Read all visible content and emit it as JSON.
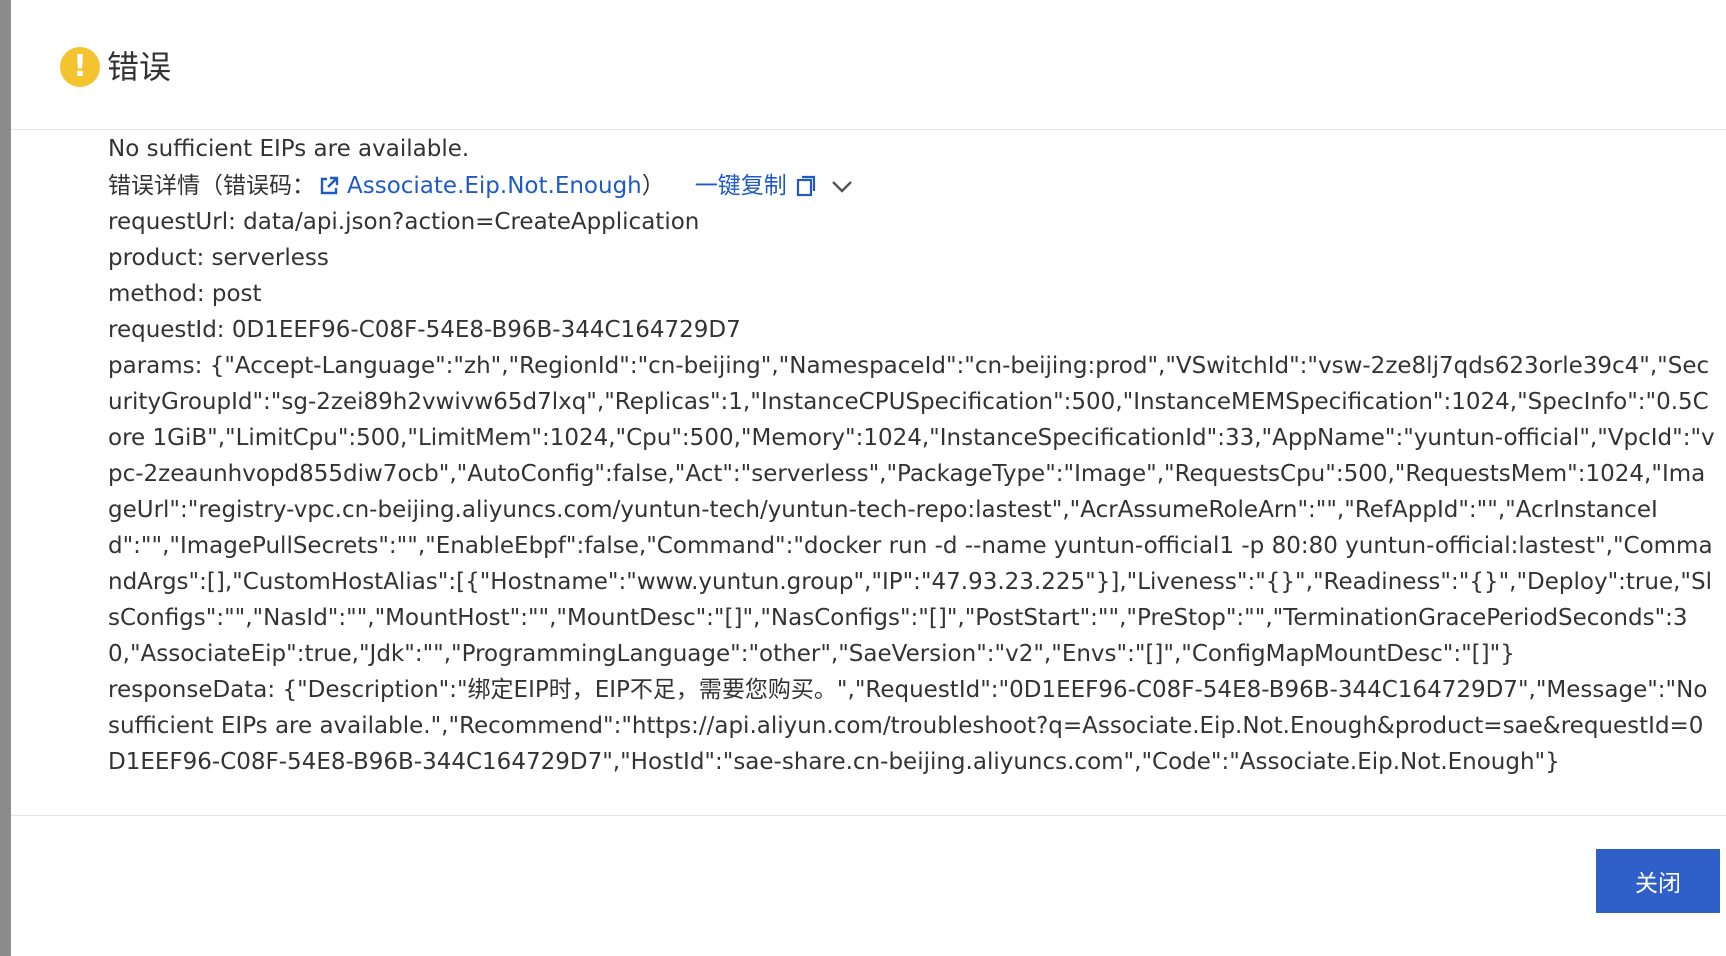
{
  "dialog": {
    "title": "错误",
    "icon": "warning-icon",
    "accent_color": "#f4c430"
  },
  "content": {
    "message": "No sufficient EIPs are available.",
    "detail_prefix": "错误详情（错误码：",
    "error_code": "Associate.Eip.Not.Enough",
    "detail_suffix": "）",
    "copy_label": "一键复制",
    "link_color": "#1f5bc6",
    "request_url": "requestUrl: data/api.json?action=CreateApplication",
    "product": "product: serverless",
    "method": "method: post",
    "request_id": "requestId: 0D1EEF96-C08F-54E8-B96B-344C164729D7",
    "params": "params: {\"Accept-Language\":\"zh\",\"RegionId\":\"cn-beijing\",\"NamespaceId\":\"cn-beijing:prod\",\"VSwitchId\":\"vsw-2ze8lj7qds623orle39c4\",\"SecurityGroupId\":\"sg-2zei89h2vwivw65d7lxq\",\"Replicas\":1,\"InstanceCPUSpecification\":500,\"InstanceMEMSpecification\":1024,\"SpecInfo\":\"0.5Core 1GiB\",\"LimitCpu\":500,\"LimitMem\":1024,\"Cpu\":500,\"Memory\":1024,\"InstanceSpecificationId\":33,\"AppName\":\"yuntun-official\",\"VpcId\":\"vpc-2zeaunhvopd855diw7ocb\",\"AutoConfig\":false,\"Act\":\"serverless\",\"PackageType\":\"Image\",\"RequestsCpu\":500,\"RequestsMem\":1024,\"ImageUrl\":\"registry-vpc.cn-beijing.aliyuncs.com/yuntun-tech/yuntun-tech-repo:lastest\",\"AcrAssumeRoleArn\":\"\",\"RefAppId\":\"\",\"AcrInstanceId\":\"\",\"ImagePullSecrets\":\"\",\"EnableEbpf\":false,\"Command\":\"docker run -d --name yuntun-official1 -p 80:80 yuntun-official:lastest\",\"CommandArgs\":[],\"CustomHostAlias\":[{\"Hostname\":\"www.yuntun.group\",\"IP\":\"47.93.23.225\"}],\"Liveness\":\"{}\",\"Readiness\":\"{}\",\"Deploy\":true,\"SlsConfigs\":\"\",\"NasId\":\"\",\"MountHost\":\"\",\"MountDesc\":\"[]\",\"NasConfigs\":\"[]\",\"PostStart\":\"\",\"PreStop\":\"\",\"TerminationGracePeriodSeconds\":30,\"AssociateEip\":true,\"Jdk\":\"\",\"ProgrammingLanguage\":\"other\",\"SaeVersion\":\"v2\",\"Envs\":\"[]\",\"ConfigMapMountDesc\":\"[]\"}",
    "response_data": "responseData: {\"Description\":\"绑定EIP时，EIP不足，需要您购买。\",\"RequestId\":\"0D1EEF96-C08F-54E8-B96B-344C164729D7\",\"Message\":\"No sufficient EIPs are available.\",\"Recommend\":\"https://api.aliyun.com/troubleshoot?q=Associate.Eip.Not.Enough&product=sae&requestId=0D1EEF96-C08F-54E8-B96B-344C164729D7\",\"HostId\":\"sae-share.cn-beijing.aliyuncs.com\",\"Code\":\"Associate.Eip.Not.Enough\"}"
  },
  "footer": {
    "close_label": "关闭",
    "button_color": "#2f5fc9"
  }
}
